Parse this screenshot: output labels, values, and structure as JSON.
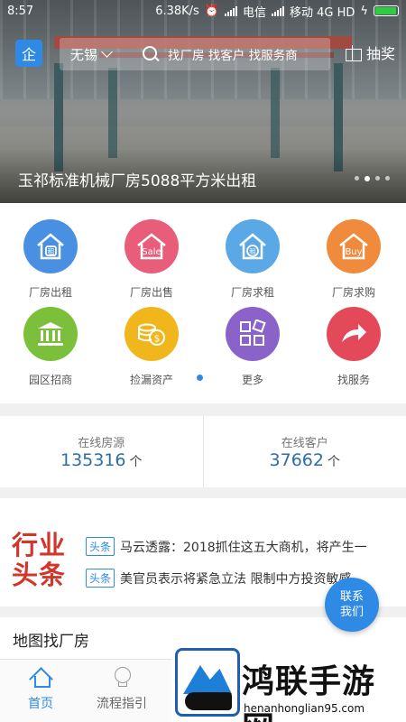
{
  "status_bar": {
    "time": "8:57",
    "speed": "6.38K/s",
    "carrier1": "电信",
    "carrier2": "移动 4G HD"
  },
  "header": {
    "enterprise_badge": "企",
    "city": "无锡",
    "search_placeholder": "找厂房 找客户 找服务商",
    "lottery": "抽奖"
  },
  "banner": {
    "caption": "玉祁标准机械厂房5088平方米出租",
    "dots": 4,
    "active_dot": 1
  },
  "categories": [
    {
      "label": "厂房出租",
      "icon": "house-rent-icon",
      "glyph": "租",
      "color": "#4a90e2"
    },
    {
      "label": "厂房出售",
      "icon": "house-sale-icon",
      "glyph": "Sale",
      "color": "#e85d7a"
    },
    {
      "label": "厂房求租",
      "icon": "house-seek-rent-icon",
      "glyph": "租",
      "color": "#5aa9e6"
    },
    {
      "label": "厂房求购",
      "icon": "house-buy-icon",
      "glyph": "Buy",
      "color": "#f08a3c"
    },
    {
      "label": "园区招商",
      "icon": "park-building-icon",
      "glyph": "",
      "color": "#7bbf3a"
    },
    {
      "label": "捡漏资产",
      "icon": "coins-icon",
      "glyph": "$",
      "color": "#f2b61d"
    },
    {
      "label": "更多",
      "icon": "more-grid-icon",
      "glyph": "",
      "color": "#8b62c9"
    },
    {
      "label": "找服务",
      "icon": "service-arrow-icon",
      "glyph": "",
      "color": "#e4495a"
    }
  ],
  "stats": {
    "listings_title": "在线房源",
    "listings_value": "135316",
    "customers_title": "在线客户",
    "customers_value": "37662",
    "unit": "个"
  },
  "news": {
    "logo_line1": "行业",
    "logo_line2": "头条",
    "items": [
      {
        "tag": "头条",
        "text": "马云透露：2018抓住这五大商机，将产生一"
      },
      {
        "tag": "头条",
        "text": "美官员表示将紧急立法 限制中方投资敏感"
      }
    ]
  },
  "map": {
    "title": "地图找厂房"
  },
  "fab": {
    "line1": "联系",
    "line2": "我们"
  },
  "bottom_nav": {
    "home": "首页",
    "guide": "流程指引"
  },
  "watermark": {
    "title": "鸿联手游网",
    "url": "henanhonglian95.com"
  }
}
